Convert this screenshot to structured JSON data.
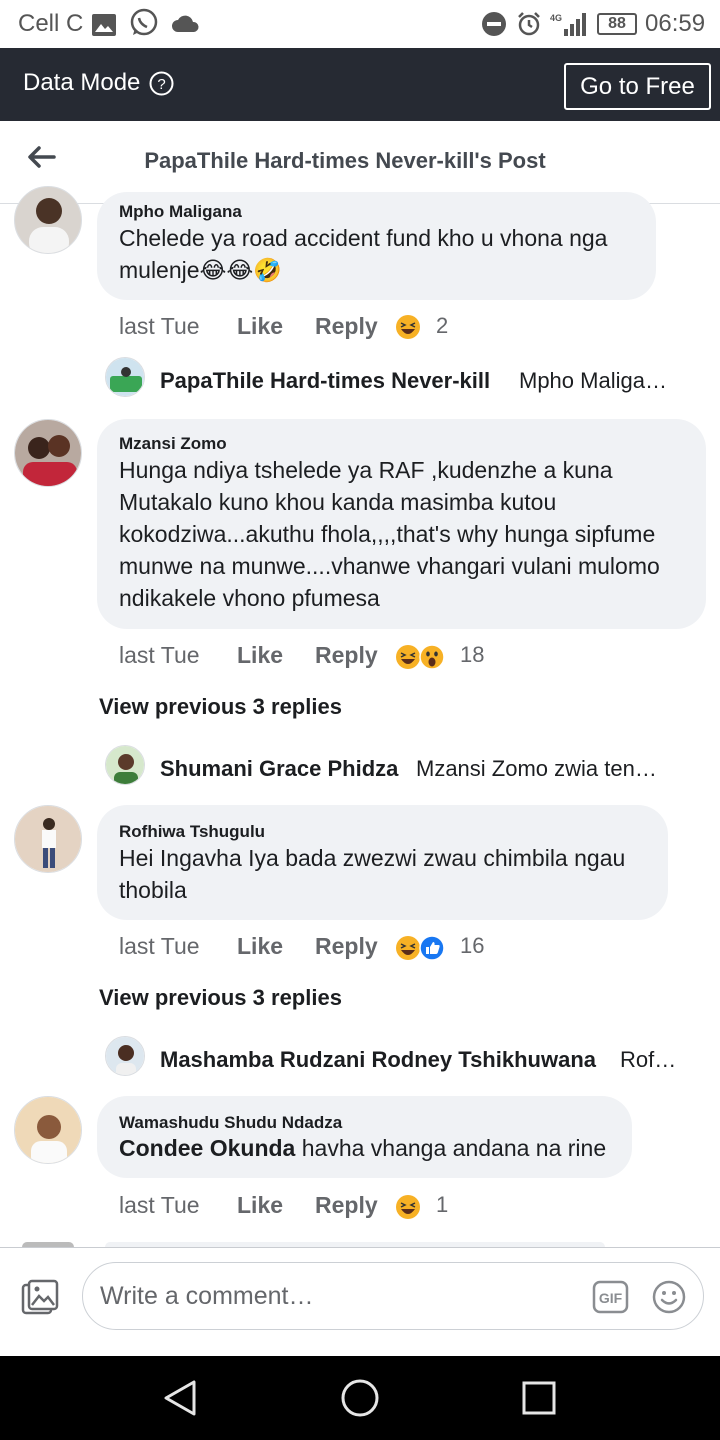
{
  "status_bar": {
    "carrier": "Cell C",
    "battery": "88",
    "time": "06:59",
    "icons": [
      "gallery-icon",
      "whatsapp-icon",
      "cloud-icon",
      "dnd-icon",
      "alarm-icon",
      "signal-icon",
      "battery-icon"
    ]
  },
  "data_bar": {
    "label": "Data Mode",
    "button": "Go to Free"
  },
  "header": {
    "title": "PapaThile Hard-times Never-kill's Post"
  },
  "comments": [
    {
      "author": "Mpho Maligana",
      "text": "Chelede ya road accident fund  kho u vhona nga mulenje",
      "emoji_inline": [
        "😂",
        "😂",
        "🤣"
      ],
      "time": "last Tue",
      "like": "Like",
      "reply": "Reply",
      "reactions": [
        "haha"
      ],
      "count": "2",
      "reply_preview": {
        "name": "PapaThile Hard-times Never-kill",
        "text": "Mpho Maliga…"
      }
    },
    {
      "author": "Mzansi Zomo",
      "text_lines": [
        "Hunga ndiya tshelede ya RAF ,kudenzhe a kuna",
        "Mutakalo kuno khou kanda masimba kutou",
        "kokodziwa...akuthu fhola,,,,that's why hunga sipfume",
        "munwe na munwe....vhanwe vhangari vulani mulomo",
        "ndikakele vhono pfumesa"
      ],
      "time": "last Tue",
      "like": "Like",
      "reply": "Reply",
      "reactions": [
        "haha",
        "wow"
      ],
      "count": "18",
      "view_previous": "View previous 3 replies",
      "reply_preview": {
        "name": "Shumani Grace Phidza",
        "text": "Mzansi Zomo zwia ten…"
      }
    },
    {
      "author": "Rofhiwa Tshugulu",
      "text_lines": [
        "Hei Ingavha Iya bada zwezwi zwau chimbila ngau",
        "thobila"
      ],
      "time": "last Tue",
      "like": "Like",
      "reply": "Reply",
      "reactions": [
        "haha",
        "like"
      ],
      "count": "16",
      "view_previous": "View previous 3 replies",
      "reply_preview": {
        "name": "Mashamba Rudzani Rodney Tshikhuwana",
        "text": "Rof…"
      }
    },
    {
      "author": "Wamashudu Shudu Ndadza",
      "mention": "Condee Okunda",
      "text": " havha vhanga andana na rine",
      "time": "last Tue",
      "like": "Like",
      "reply": "Reply",
      "reactions": [
        "haha"
      ],
      "count": "1"
    }
  ],
  "composer": {
    "placeholder": "Write a comment…"
  },
  "navbar": {
    "icons": [
      "back-icon",
      "home-icon",
      "recent-apps-icon"
    ]
  },
  "colors": {
    "data_bar": "#262a33",
    "bubble": "#f0f2f5",
    "meta_text": "#65676b",
    "reaction_yellow": "#f7b125",
    "like_blue": "#1877f2"
  }
}
